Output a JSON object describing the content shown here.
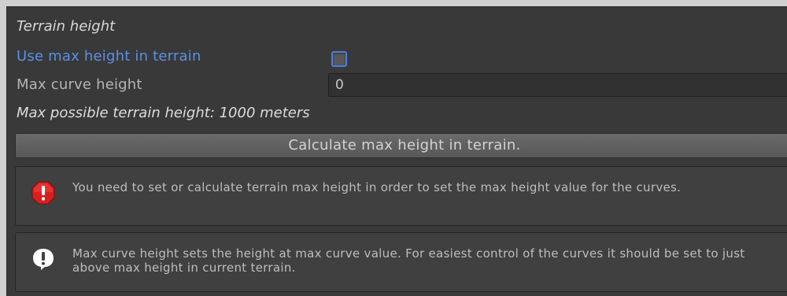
{
  "terrain_section": {
    "title": "Terrain height",
    "use_max_height_label": "Use max height in terrain",
    "use_max_height_checked": false,
    "max_curve_height_label": "Max curve height",
    "max_curve_height_value": "0",
    "max_possible_text": "Max possible terrain height: 1000 meters",
    "calculate_button_label": "Calculate max height in terrain."
  },
  "help_boxes": {
    "error": {
      "icon": "error-icon",
      "text": "You need to set or calculate terrain max height in order to set the max height value for the curves."
    },
    "info": {
      "icon": "info-icon",
      "text": "Max curve height sets the height at max curve value. For easiest control of the curves it should be set to just above max height in current terrain."
    }
  },
  "colors": {
    "panel_bg": "#393939",
    "outer_bg": "#cfcfcf",
    "highlight_label": "#5a8fe6",
    "error_red": "#d81f1f"
  }
}
